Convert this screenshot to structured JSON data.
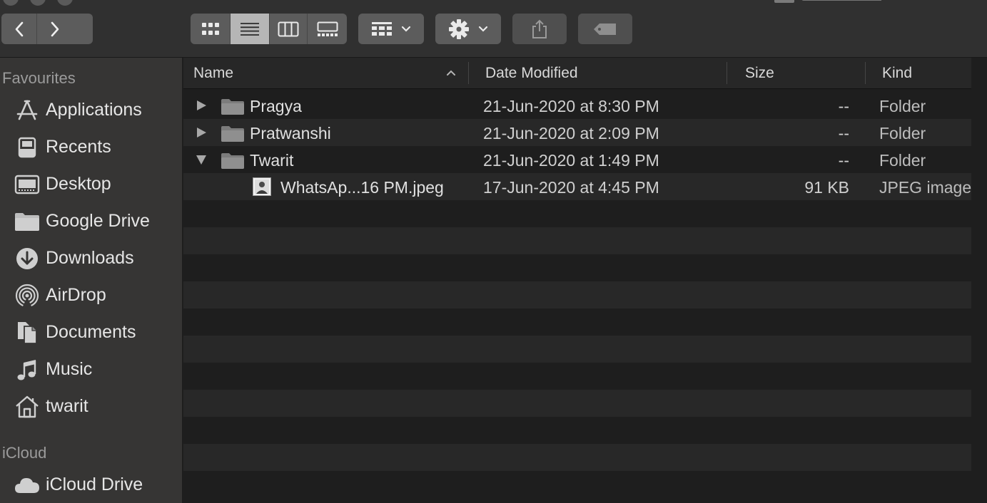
{
  "toolbar": {
    "nav_back_icon": "chevron-left-icon",
    "nav_forward_icon": "chevron-right-icon",
    "view_modes": [
      "icon-view-icon",
      "list-view-icon",
      "column-view-icon",
      "gallery-view-icon"
    ],
    "active_view": "list",
    "group_icon": "group-grid-icon",
    "action_icon": "gear-icon",
    "share_icon": "share-icon",
    "tag_icon": "tag-icon"
  },
  "sidebar": {
    "favourites_heading": "Favourites",
    "items": [
      {
        "label": "Applications",
        "icon": "applications-icon"
      },
      {
        "label": "Recents",
        "icon": "recents-icon"
      },
      {
        "label": "Desktop",
        "icon": "desktop-icon"
      },
      {
        "label": "Google Drive",
        "icon": "folder-icon"
      },
      {
        "label": "Downloads",
        "icon": "downloads-icon"
      },
      {
        "label": "AirDrop",
        "icon": "airdrop-icon"
      },
      {
        "label": "Documents",
        "icon": "documents-icon"
      },
      {
        "label": "Music",
        "icon": "music-icon"
      },
      {
        "label": "twarit",
        "icon": "home-icon"
      }
    ],
    "icloud_heading": "iCloud",
    "icloud_items": [
      {
        "label": "iCloud Drive",
        "icon": "cloud-icon"
      }
    ]
  },
  "list": {
    "columns": {
      "name": "Name",
      "date": "Date Modified",
      "size": "Size",
      "kind": "Kind"
    },
    "sort_indicator": "chevron-up-icon",
    "rows": [
      {
        "name": "Pragya",
        "date": "21-Jun-2020 at 8:30 PM",
        "size": "--",
        "kind": "Folder",
        "type": "folder",
        "expanded": false,
        "indent": 0
      },
      {
        "name": "Pratwanshi",
        "date": "21-Jun-2020 at 2:09 PM",
        "size": "--",
        "kind": "Folder",
        "type": "folder",
        "expanded": false,
        "indent": 0
      },
      {
        "name": "Twarit",
        "date": "21-Jun-2020 at 1:49 PM",
        "size": "--",
        "kind": "Folder",
        "type": "folder",
        "expanded": true,
        "indent": 0
      },
      {
        "name": "WhatsAp...16 PM.jpeg",
        "date": "17-Jun-2020 at 4:45 PM",
        "size": "91 KB",
        "kind": "JPEG image",
        "type": "image",
        "indent": 1
      }
    ]
  },
  "colors": {
    "background": "#1e1e1e",
    "sidebar": "#363534",
    "toolbar": "#303030",
    "stripe": "#282828",
    "folder": "#8f8f8f"
  }
}
